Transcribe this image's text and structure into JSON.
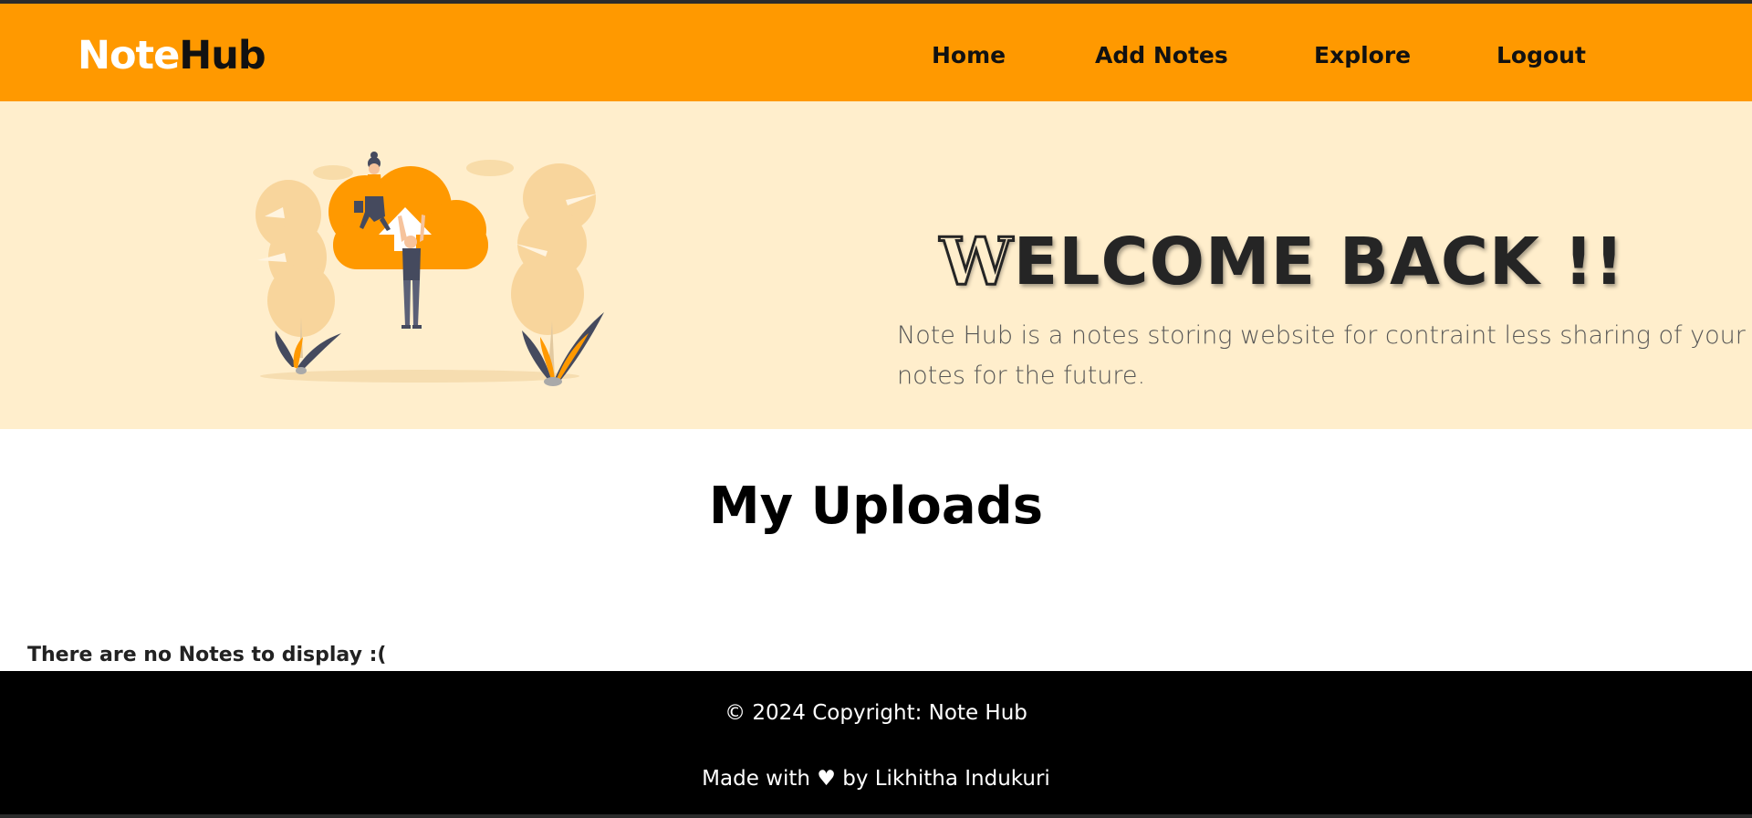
{
  "brand": {
    "part1": "Note",
    "part2": "Hub"
  },
  "nav": {
    "items": [
      {
        "label": "Home"
      },
      {
        "label": "Add Notes"
      },
      {
        "label": "Explore"
      },
      {
        "label": "Logout"
      }
    ]
  },
  "hero": {
    "welcome_first": "W",
    "welcome_rest": "ELCOME BACK !!",
    "description": "Note Hub is a notes storing website for contraint less sharing of your notes for the future."
  },
  "main": {
    "title": "My Uploads",
    "empty_message": "There are no Notes to display :("
  },
  "footer": {
    "copyright": "© 2024 Copyright: Note Hub",
    "made_prefix": "Made with",
    "heart": "♥",
    "made_suffix": "by Likhitha Indukuri"
  },
  "colors": {
    "nav_bg": "#ff9900",
    "hero_bg": "#ffeecc",
    "footer_bg": "#000000",
    "accent": "#ff9900"
  }
}
